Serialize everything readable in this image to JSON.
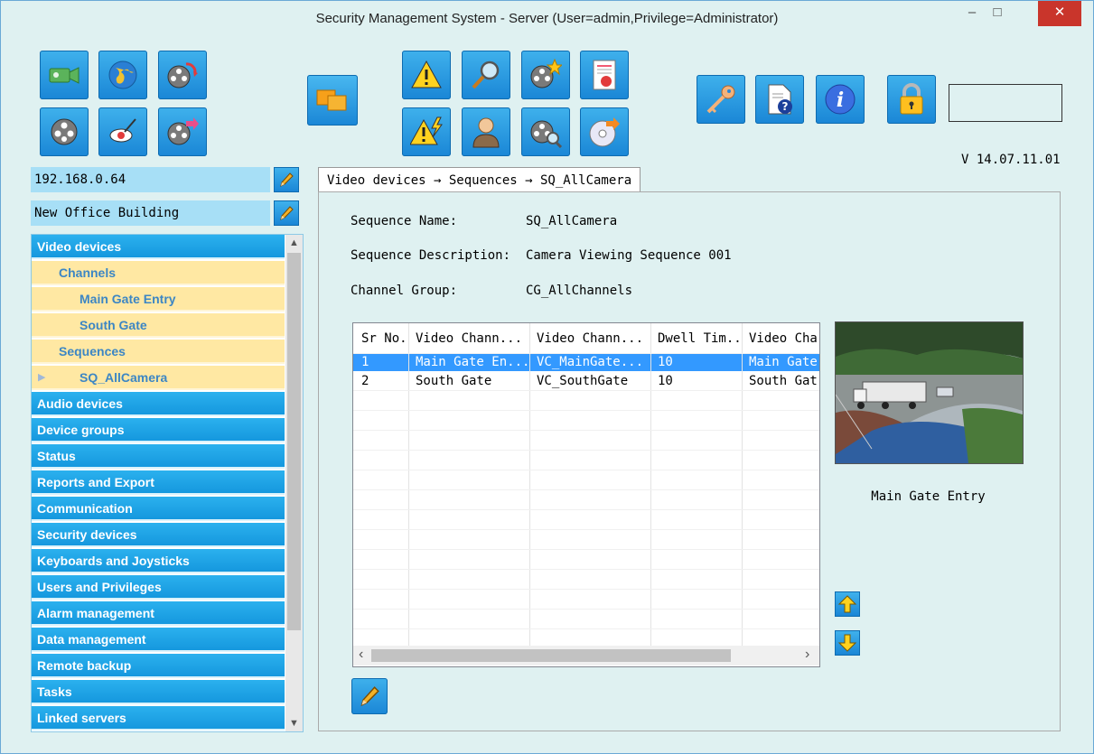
{
  "window": {
    "title": "Security Management System - Server (User=admin,Privilege=Administrator)",
    "minimize_glyph": "–",
    "maximize_glyph": "□",
    "close_glyph": "✕"
  },
  "toolbar": {
    "icons": [
      "camera-icon",
      "globe-icon",
      "film-refresh-icon",
      "film-icon",
      "map-pointer-icon",
      "film-export-icon",
      "layout-icon",
      "warning-icon",
      "magnifier-icon",
      "film-star-icon",
      "report-icon",
      "warning-flash-icon",
      "user-icon",
      "film-search-icon",
      "disc-export-icon",
      "key-icon",
      "help-document-icon",
      "info-icon",
      "lock-icon"
    ],
    "version": "V 14.07.11.01"
  },
  "server": {
    "address": "192.168.0.64",
    "site": "New Office Building"
  },
  "tree": {
    "items": [
      {
        "label": "Video devices",
        "kind": "cat"
      },
      {
        "label": "Channels",
        "kind": "sub1"
      },
      {
        "label": "Main Gate Entry",
        "kind": "sub2"
      },
      {
        "label": "South Gate",
        "kind": "sub2"
      },
      {
        "label": "Sequences",
        "kind": "sub1"
      },
      {
        "label": "SQ_AllCamera",
        "kind": "sub2sel"
      },
      {
        "label": "Audio devices",
        "kind": "cat"
      },
      {
        "label": "Device groups",
        "kind": "cat"
      },
      {
        "label": "Status",
        "kind": "cat"
      },
      {
        "label": "Reports and Export",
        "kind": "cat"
      },
      {
        "label": "Communication",
        "kind": "cat"
      },
      {
        "label": "Security devices",
        "kind": "cat"
      },
      {
        "label": "Keyboards and Joysticks",
        "kind": "cat"
      },
      {
        "label": "Users and Privileges",
        "kind": "cat"
      },
      {
        "label": "Alarm management",
        "kind": "cat"
      },
      {
        "label": "Data management",
        "kind": "cat"
      },
      {
        "label": "Remote backup",
        "kind": "cat"
      },
      {
        "label": "Tasks",
        "kind": "cat"
      },
      {
        "label": "Linked servers",
        "kind": "cat"
      }
    ]
  },
  "tab": {
    "label": "Video devices → Sequences → SQ_AllCamera"
  },
  "details": {
    "name_label": "Sequence Name:",
    "name_value": "SQ_AllCamera",
    "desc_label": "Sequence Description:",
    "desc_value": "Camera Viewing Sequence 001",
    "group_label": "Channel Group:",
    "group_value": "CG_AllChannels"
  },
  "grid": {
    "columns": [
      "Sr No.",
      "Video Chann...",
      "Video Chann...",
      "Dwell Tim...",
      "Video Cha"
    ],
    "rows": [
      [
        "1",
        "Main Gate En...",
        "VC_MainGate...",
        "10",
        "Main Gate"
      ],
      [
        "2",
        "South Gate",
        "VC_SouthGate",
        "10",
        "South Gat"
      ]
    ],
    "scroll_left": "‹",
    "scroll_right": "›"
  },
  "preview": {
    "caption": "Main Gate Entry"
  },
  "colors": {
    "accent": "#1a86d6",
    "selection": "#3399ff",
    "tree_sub_bg": "#ffe8a3",
    "tree_sub_text": "#3c86c4",
    "close_button": "#c9352b"
  }
}
